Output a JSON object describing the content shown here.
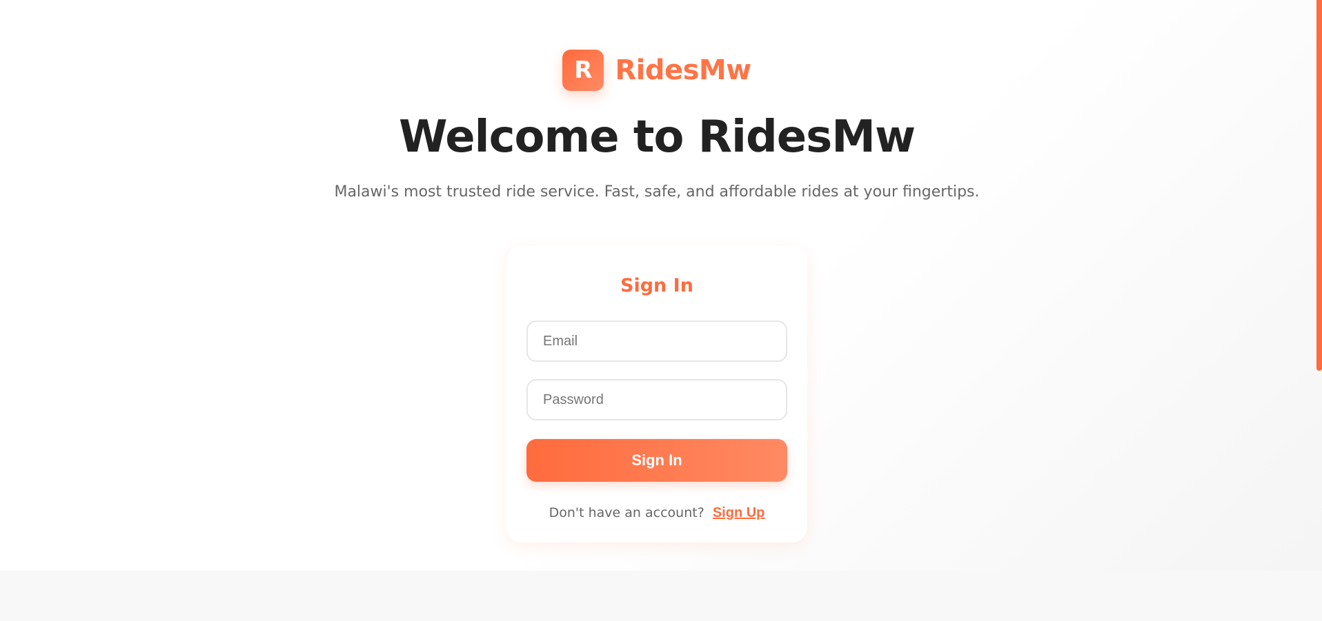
{
  "brand": {
    "logo_letter": "R",
    "name": "RidesMw",
    "accent_color": "#ff6b3d"
  },
  "hero": {
    "title": "Welcome to RidesMw",
    "subtitle": "Malawi's most trusted ride service. Fast, safe, and affordable rides at your fingertips."
  },
  "signin": {
    "heading": "Sign In",
    "email_placeholder": "Email",
    "password_placeholder": "Password",
    "submit_label": "Sign In",
    "prompt": "Don't have an account?",
    "signup_label": "Sign Up"
  }
}
